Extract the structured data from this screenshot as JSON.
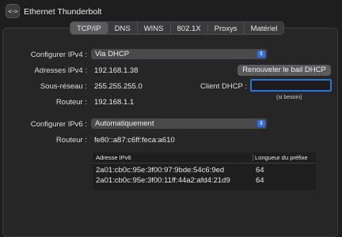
{
  "window": {
    "title": "Ethernet Thunderbolt",
    "icon": "network-arrows-icon"
  },
  "tabs": [
    {
      "label": "TCP/IP",
      "active": true
    },
    {
      "label": "DNS",
      "active": false
    },
    {
      "label": "WINS",
      "active": false
    },
    {
      "label": "802.1X",
      "active": false
    },
    {
      "label": "Proxys",
      "active": false
    },
    {
      "label": "Matériel",
      "active": false
    }
  ],
  "ipv4": {
    "configure_label": "Configurer IPv4 :",
    "configure_value": "Via DHCP",
    "address_label": "Adresses IPv4 :",
    "address_value": "192.168.1.38",
    "renew_button": "Renouveler le bail DHCP",
    "subnet_label": "Sous-réseau :",
    "subnet_value": "255.255.255.0",
    "dhcp_client_label": "Client DHCP :",
    "dhcp_client_value": "",
    "dhcp_client_hint": "(si besoin)",
    "router_label": "Routeur :",
    "router_value": "192.168.1.1"
  },
  "ipv6": {
    "configure_label": "Configurer IPv6 :",
    "configure_value": "Automatiquement",
    "router_label": "Routeur :",
    "router_value": "fe80::a87:c6ff:feca:a610",
    "table_headers": [
      "Adresse IPv6",
      "Longueur du préfixe"
    ],
    "table_rows": [
      [
        "2a01:cb0c:95e:3f00:97:9bde:54c6:9ed",
        "64"
      ],
      [
        "2a01:cb0c:95e:3f00:11ff:44a2:afd4:21d9",
        "64"
      ]
    ]
  },
  "colors": {
    "accent": "#2f6fe0",
    "background": "#1e1e1e"
  }
}
